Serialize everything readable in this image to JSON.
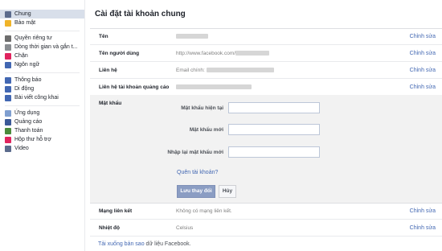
{
  "sidebar": {
    "groups": [
      [
        {
          "label": "Chung",
          "icon": "gear-icon",
          "color": "#5b6b8c",
          "active": true
        },
        {
          "label": "Bảo mật",
          "icon": "lock-icon",
          "color": "#f0b429"
        }
      ],
      [
        {
          "label": "Quyền riêng tư",
          "icon": "privacy-lock-icon",
          "color": "#6d6d6d"
        },
        {
          "label": "Dòng thời gian và gắn t...",
          "icon": "timeline-icon",
          "color": "#8a8d91"
        },
        {
          "label": "Chặn",
          "icon": "block-icon",
          "color": "#e0245e"
        },
        {
          "label": "Ngôn ngữ",
          "icon": "language-icon",
          "color": "#4267b2"
        }
      ],
      [
        {
          "label": "Thông báo",
          "icon": "globe-icon",
          "color": "#4267b2"
        },
        {
          "label": "Di động",
          "icon": "mobile-icon",
          "color": "#4267b2"
        },
        {
          "label": "Bài viết công khai",
          "icon": "rss-icon",
          "color": "#4267b2"
        }
      ],
      [
        {
          "label": "Ứng dụng",
          "icon": "apps-icon",
          "color": "#7f9fd0"
        },
        {
          "label": "Quảng cáo",
          "icon": "ads-icon",
          "color": "#3b5998"
        },
        {
          "label": "Thanh toán",
          "icon": "payment-icon",
          "color": "#4b8b3b"
        },
        {
          "label": "Hộp thư hỗ trợ",
          "icon": "support-icon",
          "color": "#e0245e"
        },
        {
          "label": "Video",
          "icon": "video-icon",
          "color": "#5b6b8c"
        }
      ]
    ]
  },
  "main": {
    "title": "Cài đặt tài khoản chung",
    "edit_label": "Chỉnh sửa",
    "rows_top": [
      {
        "label": "Tên",
        "value": ""
      },
      {
        "label": "Tên người dùng",
        "value": "http://www.facebook.com/"
      },
      {
        "label": "Liên hệ",
        "value": "Email chính:"
      },
      {
        "label": "Liên hệ tài khoản quảng cáo",
        "value": ""
      }
    ],
    "password": {
      "section_label": "Mật khẩu",
      "current_label": "Mật khẩu hiện tại",
      "new_label": "Mật khẩu mới",
      "retype_label": "Nhập lại mật khẩu mới",
      "forgot_label": "Quên tài khoản?",
      "save_label": "Lưu thay đổi",
      "cancel_label": "Hủy"
    },
    "rows_bottom": [
      {
        "label": "Mạng liên kết",
        "value": "Không có mạng liên kết."
      },
      {
        "label": "Nhiệt độ",
        "value": "Celsius"
      }
    ],
    "footer": {
      "link_text": "Tải xuống bản sao",
      "rest_text": " dữ liệu Facebook."
    }
  }
}
